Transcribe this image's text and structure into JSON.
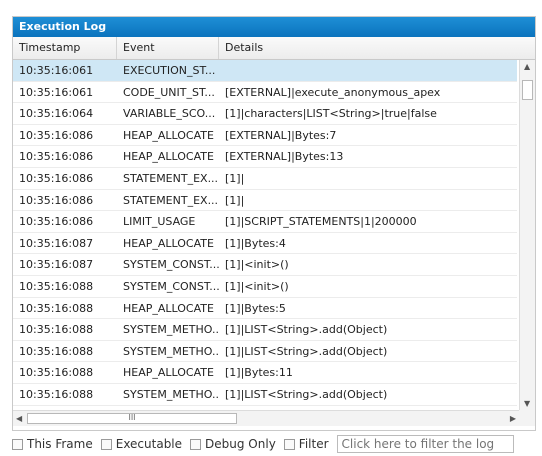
{
  "panel": {
    "title": "Execution Log",
    "columns": [
      "Timestamp",
      "Event",
      "Details"
    ],
    "rows": [
      {
        "ts": "10:35:16:061",
        "event": "EXECUTION_ST...",
        "details": "",
        "selected": true
      },
      {
        "ts": "10:35:16:061",
        "event": "CODE_UNIT_ST...",
        "details": "[EXTERNAL]|execute_anonymous_apex"
      },
      {
        "ts": "10:35:16:064",
        "event": "VARIABLE_SCO...",
        "details": "[1]|characters|LIST<String>|true|false"
      },
      {
        "ts": "10:35:16:086",
        "event": "HEAP_ALLOCATE",
        "details": "[EXTERNAL]|Bytes:7"
      },
      {
        "ts": "10:35:16:086",
        "event": "HEAP_ALLOCATE",
        "details": "[EXTERNAL]|Bytes:13"
      },
      {
        "ts": "10:35:16:086",
        "event": "STATEMENT_EX...",
        "details": "[1]|"
      },
      {
        "ts": "10:35:16:086",
        "event": "STATEMENT_EX...",
        "details": "[1]|"
      },
      {
        "ts": "10:35:16:086",
        "event": "LIMIT_USAGE",
        "details": "[1]|SCRIPT_STATEMENTS|1|200000"
      },
      {
        "ts": "10:35:16:087",
        "event": "HEAP_ALLOCATE",
        "details": "[1]|Bytes:4"
      },
      {
        "ts": "10:35:16:087",
        "event": "SYSTEM_CONST...",
        "details": "[1]|<init>()"
      },
      {
        "ts": "10:35:16:088",
        "event": "SYSTEM_CONST...",
        "details": "[1]|<init>()"
      },
      {
        "ts": "10:35:16:088",
        "event": "HEAP_ALLOCATE",
        "details": "[1]|Bytes:5"
      },
      {
        "ts": "10:35:16:088",
        "event": "SYSTEM_METHO...",
        "details": "[1]|LIST<String>.add(Object)"
      },
      {
        "ts": "10:35:16:088",
        "event": "SYSTEM_METHO...",
        "details": "[1]|LIST<String>.add(Object)"
      },
      {
        "ts": "10:35:16:088",
        "event": "HEAP_ALLOCATE",
        "details": "[1]|Bytes:11"
      },
      {
        "ts": "10:35:16:088",
        "event": "SYSTEM_METHO...",
        "details": "[1]|LIST<String>.add(Object)"
      }
    ],
    "hscroll_glyph": "III"
  },
  "footer": {
    "checkboxes": [
      "This Frame",
      "Executable",
      "Debug Only",
      "Filter"
    ],
    "filter_placeholder": "Click here to filter the log"
  },
  "colors": {
    "title_bar": "#0b73bd",
    "selected_row": "#cfe7f5"
  }
}
